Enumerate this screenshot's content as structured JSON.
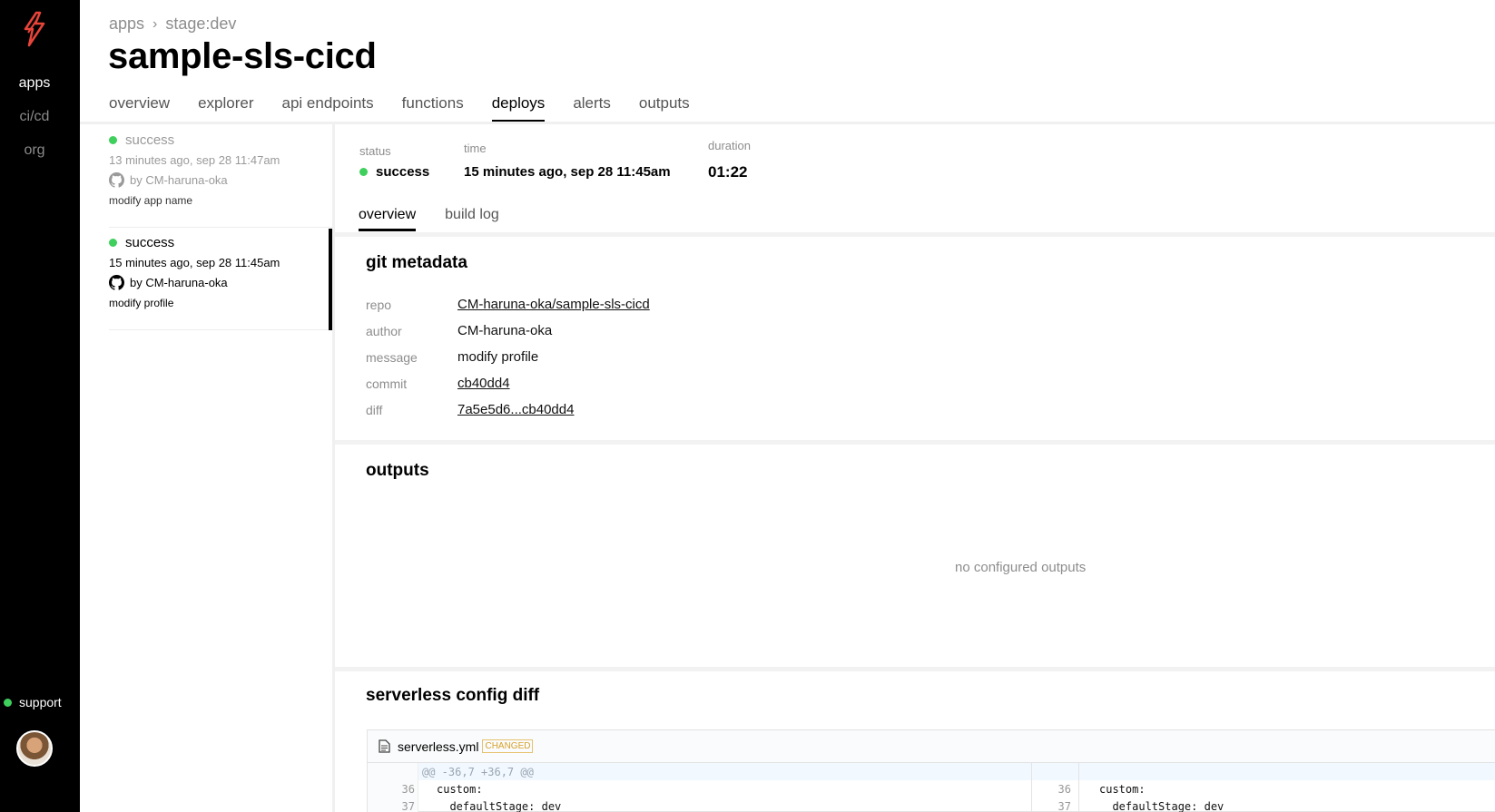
{
  "nav": {
    "items": [
      "apps",
      "ci/cd",
      "org"
    ],
    "support_label": "support"
  },
  "header": {
    "breadcrumb": [
      "apps",
      "stage:dev"
    ],
    "title": "sample-sls-cicd",
    "tabs": [
      "overview",
      "explorer",
      "api endpoints",
      "functions",
      "deploys",
      "alerts",
      "outputs"
    ],
    "active_tab": "deploys"
  },
  "deploys": [
    {
      "status": "success",
      "time": "13 minutes ago, sep 28 11:47am",
      "by": "by CM-haruna-oka",
      "message": "modify app name"
    },
    {
      "status": "success",
      "time": "15 minutes ago, sep 28 11:45am",
      "by": "by CM-haruna-oka",
      "message": "modify profile"
    }
  ],
  "detail": {
    "status_label": "status",
    "status_value": "success",
    "time_label": "time",
    "time_value": "15 minutes ago, sep 28 11:45am",
    "duration_label": "duration",
    "duration_value": "01:22",
    "subtabs": [
      "overview",
      "build log"
    ],
    "active_subtab": "overview"
  },
  "git_metadata": {
    "title": "git metadata",
    "rows": [
      {
        "label": "repo",
        "value": "CM-haruna-oka/sample-sls-cicd"
      },
      {
        "label": "author",
        "value": "CM-haruna-oka"
      },
      {
        "label": "message",
        "value": "modify profile"
      },
      {
        "label": "commit",
        "value": "cb40dd4"
      },
      {
        "label": "diff",
        "value": "7a5e5d6...cb40dd4"
      }
    ]
  },
  "outputs": {
    "title": "outputs",
    "empty_text": "no configured outputs"
  },
  "config_diff": {
    "title": "serverless config diff",
    "file_name": "serverless.yml",
    "badge": "CHANGED",
    "hunk": "@@ -36,7 +36,7 @@",
    "left_lines": [
      {
        "num": "36",
        "code": "custom:"
      },
      {
        "num": "37",
        "code": "  defaultStage: dev"
      }
    ],
    "right_lines": [
      {
        "num": "36",
        "code": "custom:"
      },
      {
        "num": "37",
        "code": "  defaultStage: dev"
      }
    ]
  },
  "colors": {
    "success": "#3ecf5c",
    "rail": "#000000",
    "logo": "#e8443a",
    "badge": "#d6a22b"
  },
  "icons": [
    "serverless-logo-icon",
    "github-icon",
    "file-icon",
    "status-dot-icon",
    "chevron-right-icon"
  ]
}
